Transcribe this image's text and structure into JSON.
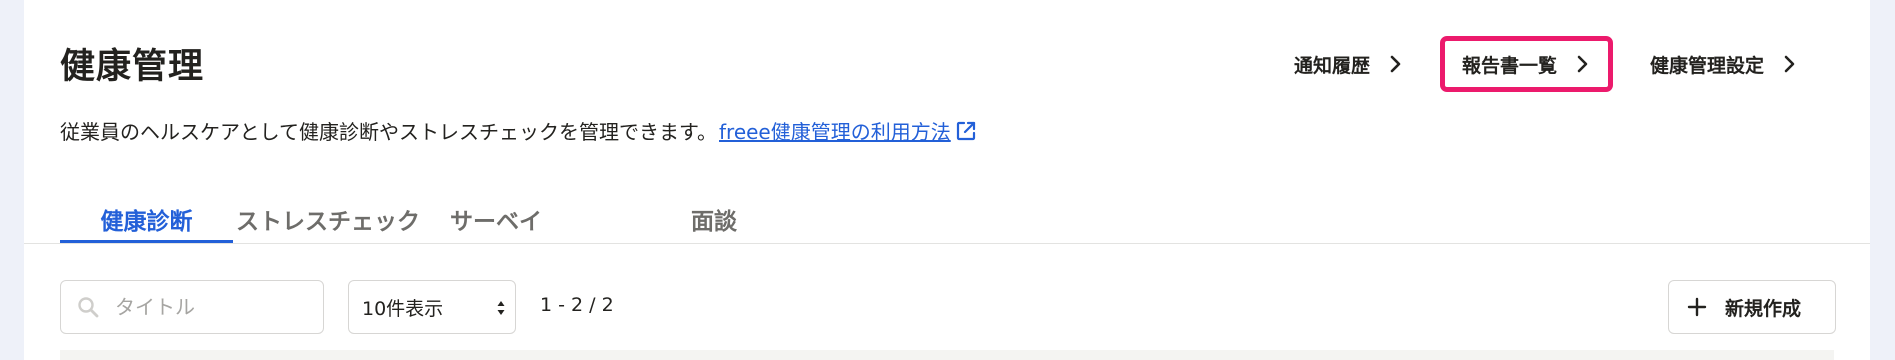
{
  "header": {
    "title": "健康管理",
    "nav": [
      {
        "label": "通知履歴",
        "icon": "chevron-right-icon"
      },
      {
        "label": "報告書一覧",
        "icon": "chevron-right-icon",
        "highlighted": true
      },
      {
        "label": "健康管理設定",
        "icon": "chevron-right-icon"
      }
    ]
  },
  "description": {
    "text": "従業員のヘルスケアとして健康診断やストレスチェックを管理できます。",
    "link_label": "freee健康管理の利用方法",
    "link_icon": "external-link-icon"
  },
  "tabs": [
    {
      "label": "健康診断",
      "active": true
    },
    {
      "label": "ストレスチェック",
      "active": false
    },
    {
      "label": "サーベイ",
      "active": false
    },
    {
      "label": "面談",
      "active": false
    }
  ],
  "toolbar": {
    "search": {
      "placeholder": "タイトル",
      "value": "",
      "icon": "search-icon"
    },
    "per_page": {
      "value": "10件表示",
      "icon": "select-arrows-icon"
    },
    "pagination": "1 - 2 / 2",
    "new_button": {
      "label": "新規作成",
      "icon": "plus-icon"
    }
  },
  "colors": {
    "accent": "#2360d8",
    "highlight": "#ec1a6c",
    "text": "#23221f",
    "muted": "#6e6d6a",
    "page_bg": "#eef1f9"
  }
}
